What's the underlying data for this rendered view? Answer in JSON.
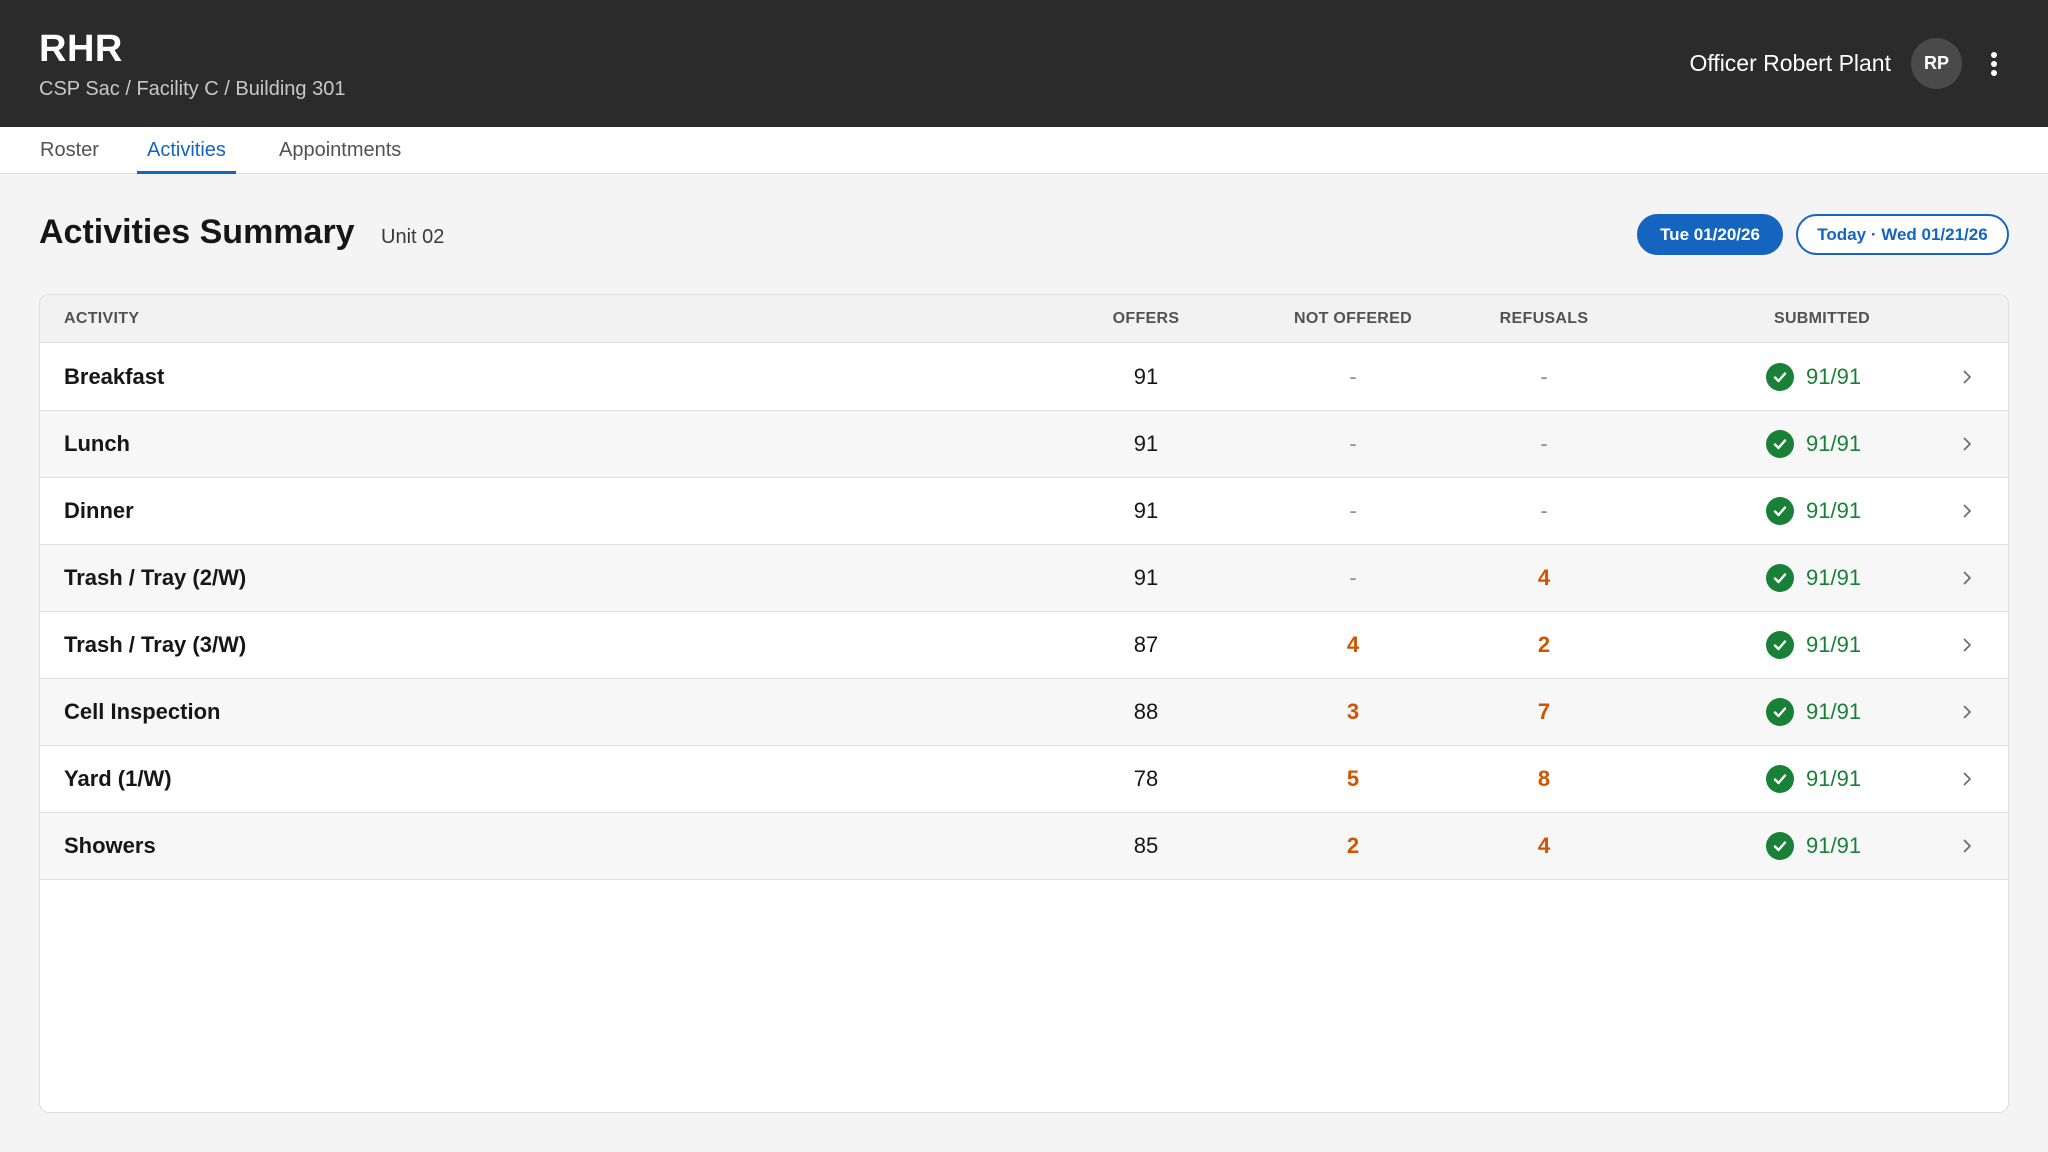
{
  "header": {
    "app_title": "RHR",
    "breadcrumb": "CSP Sac / Facility C / Building 301",
    "user_name": "Officer Robert Plant",
    "avatar_initials": "RP",
    "menu_icon": "more-vertical-icon"
  },
  "tabs": [
    {
      "label": "Roster",
      "active": false
    },
    {
      "label": "Activities",
      "active": true
    },
    {
      "label": "Appointments",
      "active": false
    }
  ],
  "summary": {
    "title": "Activities Summary",
    "unit": "Unit 02",
    "date_selected": "Tue 01/20/26",
    "date_today": "Today · Wed 01/21/26"
  },
  "table": {
    "columns": [
      "ACTIVITY",
      "OFFERS",
      "NOT OFFERED",
      "REFUSALS",
      "SUBMITTED"
    ],
    "rows": [
      {
        "activity": "Breakfast",
        "offers": "91",
        "not_offered": "-",
        "refusals": "-",
        "submitted": "91/91"
      },
      {
        "activity": "Lunch",
        "offers": "91",
        "not_offered": "-",
        "refusals": "-",
        "submitted": "91/91"
      },
      {
        "activity": "Dinner",
        "offers": "91",
        "not_offered": "-",
        "refusals": "-",
        "submitted": "91/91"
      },
      {
        "activity": "Trash / Tray (2/W)",
        "offers": "91",
        "not_offered": "-",
        "refusals": "4",
        "submitted": "91/91"
      },
      {
        "activity": "Trash / Tray (3/W)",
        "offers": "87",
        "not_offered": "4",
        "refusals": "2",
        "submitted": "91/91"
      },
      {
        "activity": "Cell Inspection",
        "offers": "88",
        "not_offered": "3",
        "refusals": "7",
        "submitted": "91/91"
      },
      {
        "activity": "Yard (1/W)",
        "offers": "78",
        "not_offered": "5",
        "refusals": "8",
        "submitted": "91/91"
      },
      {
        "activity": "Showers",
        "offers": "85",
        "not_offered": "2",
        "refusals": "4",
        "submitted": "91/91"
      }
    ]
  },
  "colors": {
    "header_bg": "#2b2b2b",
    "accent": "#1565c0",
    "success": "#198038",
    "warning": "#d35400"
  }
}
